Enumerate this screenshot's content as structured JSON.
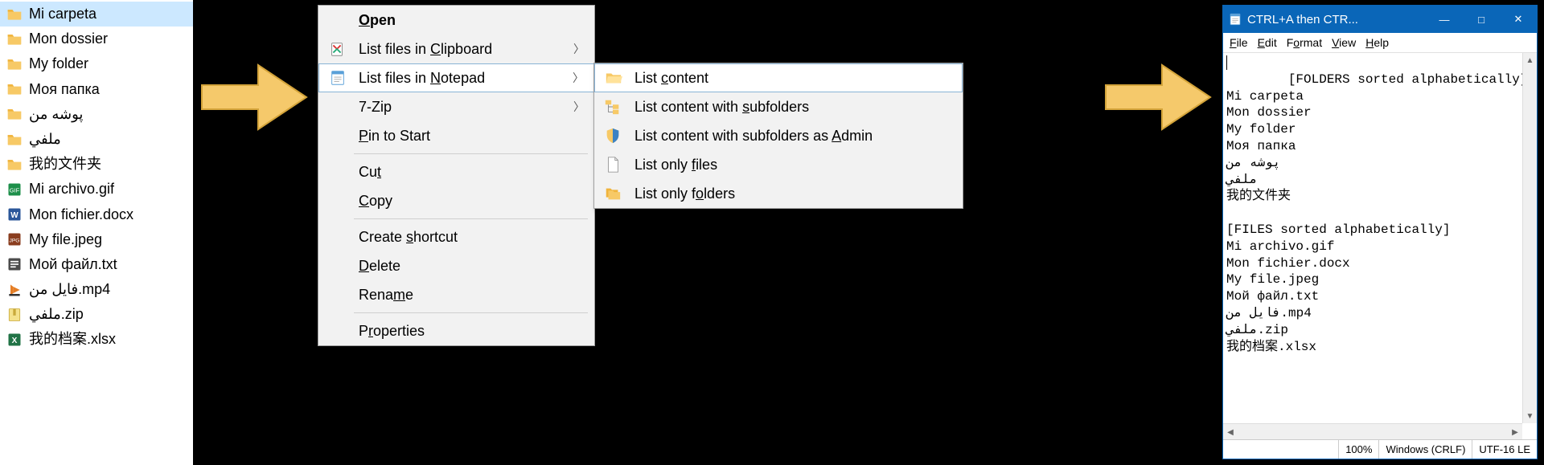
{
  "explorer": {
    "items": [
      {
        "name": "Mi carpeta",
        "icon": "folder",
        "selected": true
      },
      {
        "name": "Mon dossier",
        "icon": "folder"
      },
      {
        "name": "My folder",
        "icon": "folder"
      },
      {
        "name": "Моя папка",
        "icon": "folder"
      },
      {
        "name": "پوشه من",
        "icon": "folder"
      },
      {
        "name": "ملفي",
        "icon": "folder"
      },
      {
        "name": "我的文件夹",
        "icon": "folder"
      },
      {
        "name": "Mi archivo.gif",
        "icon": "gif"
      },
      {
        "name": "Mon fichier.docx",
        "icon": "docx"
      },
      {
        "name": "My file.jpeg",
        "icon": "jpeg"
      },
      {
        "name": "Мой файл.txt",
        "icon": "txt"
      },
      {
        "name": "فايل من.mp4",
        "icon": "mp4"
      },
      {
        "name": "ملفي.zip",
        "icon": "zip"
      },
      {
        "name": "我的档案.xlsx",
        "icon": "xlsx"
      }
    ]
  },
  "context_menu": {
    "open": "Open",
    "list_clipboard": "List files in Clipboard",
    "list_notepad": "List files in Notepad",
    "seven_zip": "7-Zip",
    "pin": "Pin to Start",
    "cut": "Cut",
    "copy": "Copy",
    "create_shortcut": "Create shortcut",
    "delete": "Delete",
    "rename": "Rename",
    "properties": "Properties"
  },
  "submenu": {
    "list_content": "List content",
    "list_subfolders": "List content with subfolders",
    "list_admin": "List content with subfolders as Admin",
    "list_files": "List only files",
    "list_folders": "List only folders"
  },
  "notepad": {
    "title": "CTRL+A then CTR...",
    "menu": {
      "file": "File",
      "edit": "Edit",
      "format": "Format",
      "view": "View",
      "help": "Help"
    },
    "content": "[FOLDERS sorted alphabetically]\nMi carpeta\nMon dossier\nMy folder\nМоя папка\nپوشه من\nملفي\n我的文件夹\n\n[FILES sorted alphabetically]\nMi archivo.gif\nMon fichier.docx\nMy file.jpeg\nМой файл.txt\nفايل من.mp4\nملفي.zip\n我的档案.xlsx",
    "status": {
      "zoom": "100%",
      "eol": "Windows (CRLF)",
      "enc": "UTF-16 LE"
    }
  }
}
